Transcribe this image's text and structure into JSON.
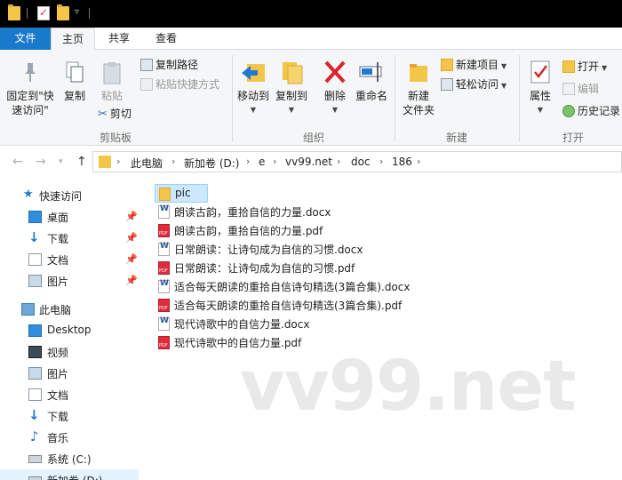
{
  "window": {
    "titlebar_icons": [
      "folder-icon",
      "properties-check-icon",
      "new-folder-icon",
      "dropdown-arrow-icon"
    ]
  },
  "ribbon_tabs": {
    "file": "文件",
    "home": "主页",
    "share": "共享",
    "view": "查看"
  },
  "ribbon": {
    "pin_quick_access": "固定到\"快\n速访问\"",
    "copy": "复制",
    "paste": "粘贴",
    "copy_path": "复制路径",
    "paste_shortcut": "粘贴快捷方式",
    "cut": "剪切",
    "group_clipboard": "剪贴板",
    "move_to": "移动到",
    "copy_to": "复制到",
    "delete": "删除",
    "rename": "重命名",
    "group_organize": "组织",
    "new_folder": "新建\n文件夹",
    "new_item": "新建项目",
    "easy_access": "轻松访问",
    "group_new": "新建",
    "properties": "属性",
    "open": "打开",
    "edit": "编辑",
    "history": "历史记录",
    "group_open": "打开"
  },
  "address": {
    "crumbs": [
      "此电脑",
      "新加卷 (D:)",
      "e",
      "vv99.net",
      "doc",
      "186"
    ]
  },
  "nav": {
    "quick_access": "快速访问",
    "desktop": "桌面",
    "downloads": "下载",
    "documents": "文档",
    "pictures": "图片",
    "this_pc": "此电脑",
    "pc_desktop": "Desktop",
    "pc_videos": "视频",
    "pc_pictures": "图片",
    "pc_documents": "文档",
    "pc_downloads": "下载",
    "pc_music": "音乐",
    "drive_c": "系统 (C:)",
    "drive_d": "新加卷 (D:)"
  },
  "files": [
    {
      "name": "pic",
      "type": "folder"
    },
    {
      "name": "朗读古韵，重拾自信的力量.docx",
      "type": "docx"
    },
    {
      "name": "朗读古韵，重拾自信的力量.pdf",
      "type": "pdf"
    },
    {
      "name": "日常朗读：让诗句成为自信的习惯.docx",
      "type": "docx"
    },
    {
      "name": "日常朗读：让诗句成为自信的习惯.pdf",
      "type": "pdf"
    },
    {
      "name": "适合每天朗读的重拾自信诗句精选(3篇合集).docx",
      "type": "docx"
    },
    {
      "name": "适合每天朗读的重拾自信诗句精选(3篇合集).pdf",
      "type": "pdf"
    },
    {
      "name": "现代诗歌中的自信力量.docx",
      "type": "docx"
    },
    {
      "name": "现代诗歌中的自信力量.pdf",
      "type": "pdf"
    }
  ],
  "watermark": "vv99.net",
  "colors": {
    "accent": "#1979ca",
    "selection": "#cce8ff",
    "folder": "#f3c64a",
    "pdf": "#e02b3c",
    "word": "#2b579a"
  }
}
